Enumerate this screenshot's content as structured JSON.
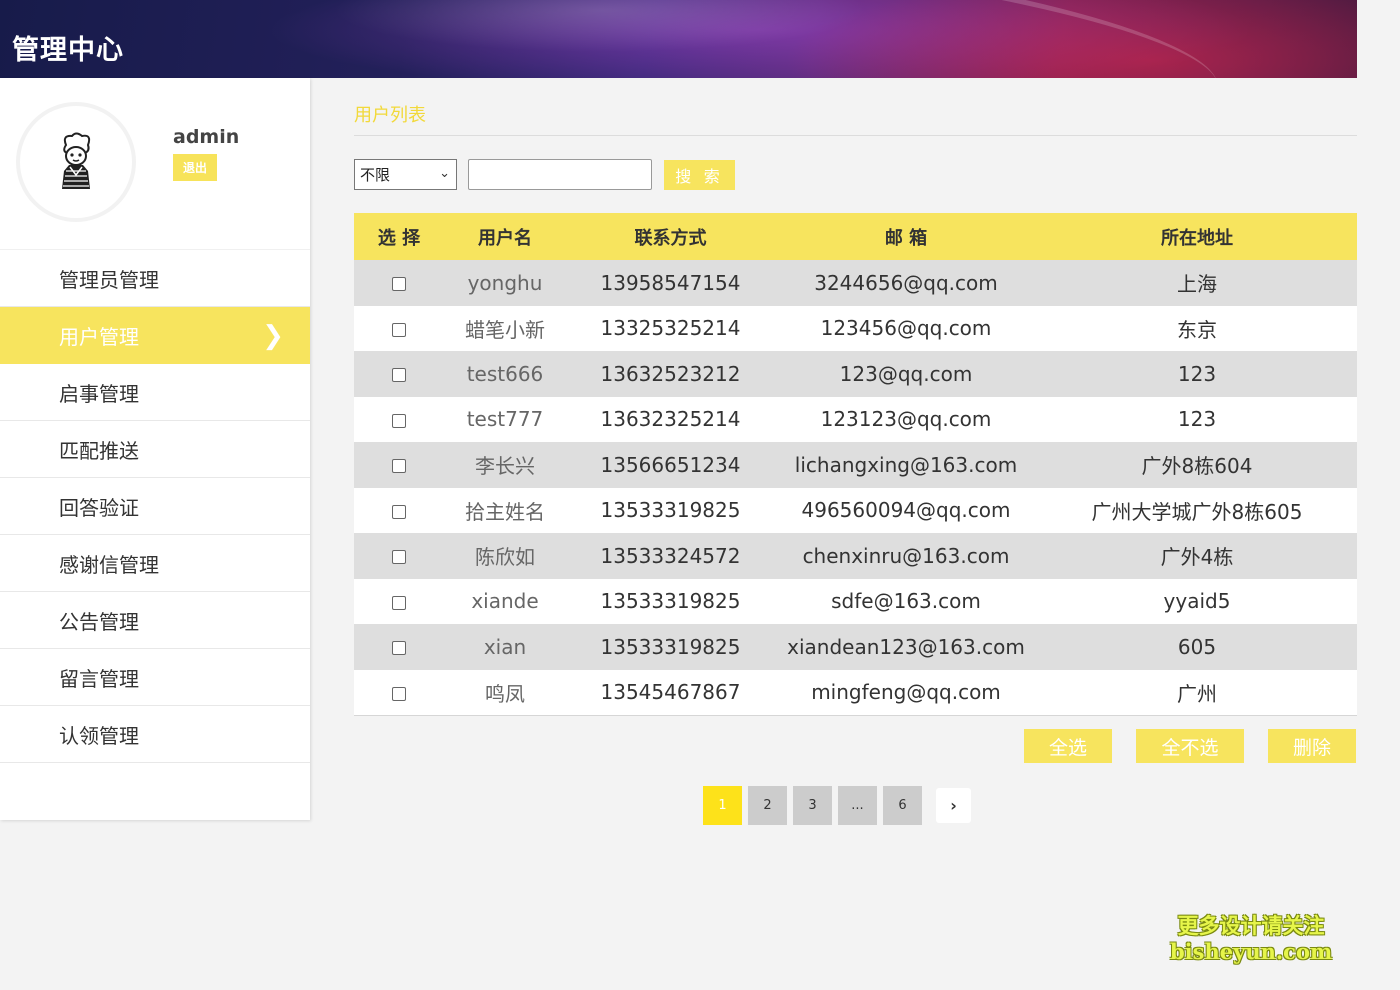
{
  "header": {
    "title": "管理中心"
  },
  "profile": {
    "username": "admin",
    "logout_label": "退出"
  },
  "menu": [
    {
      "label": "管理员管理",
      "active": false
    },
    {
      "label": "用户管理",
      "active": true
    },
    {
      "label": "启事管理",
      "active": false
    },
    {
      "label": "匹配推送",
      "active": false
    },
    {
      "label": "回答验证",
      "active": false
    },
    {
      "label": "感谢信管理",
      "active": false
    },
    {
      "label": "公告管理",
      "active": false
    },
    {
      "label": "留言管理",
      "active": false
    },
    {
      "label": "认领管理",
      "active": false
    }
  ],
  "main": {
    "section_title": "用户列表",
    "filter": {
      "selected": "不限"
    },
    "search": {
      "value": "",
      "button_label": "搜 索"
    },
    "table": {
      "headers": [
        "选 择",
        "用户名",
        "联系方式",
        "邮 箱",
        "所在地址"
      ],
      "rows": [
        {
          "username": "yonghu",
          "phone": "13958547154",
          "email": "3244656@qq.com",
          "address": "上海",
          "checked": false
        },
        {
          "username": "蜡笔小新",
          "phone": "13325325214",
          "email": "123456@qq.com",
          "address": "东京",
          "checked": false
        },
        {
          "username": "test666",
          "phone": "13632523212",
          "email": "123@qq.com",
          "address": "123",
          "checked": false
        },
        {
          "username": "test777",
          "phone": "13632325214",
          "email": "123123@qq.com",
          "address": "123",
          "checked": false
        },
        {
          "username": "李长兴",
          "phone": "13566651234",
          "email": "lichangxing@163.com",
          "address": "广外8栋604",
          "checked": false
        },
        {
          "username": "拾主姓名",
          "phone": "13533319825",
          "email": "496560094@qq.com",
          "address": "广州大学城广外8栋605",
          "checked": false
        },
        {
          "username": "陈欣如",
          "phone": "13533324572",
          "email": "chenxinru@163.com",
          "address": "广外4栋",
          "checked": false
        },
        {
          "username": "xiande",
          "phone": "13533319825",
          "email": "sdfe@163.com",
          "address": "yyaid5",
          "checked": false
        },
        {
          "username": "xian",
          "phone": "13533319825",
          "email": "xiandean123@163.com",
          "address": "605",
          "checked": false
        },
        {
          "username": "鸣凤",
          "phone": "13545467867",
          "email": "mingfeng@qq.com",
          "address": "广州",
          "checked": false
        }
      ]
    },
    "actions": {
      "select_all": "全选",
      "select_none": "全不选",
      "delete": "删除"
    },
    "pagination": {
      "pages": [
        "1",
        "2",
        "3",
        "...",
        "6"
      ],
      "current": "1",
      "next_icon": "chevron-right-icon"
    }
  },
  "watermark": {
    "line1": "更多设计请关注",
    "line2": "bisheyun.com"
  },
  "colors": {
    "accent": "#f7e45e",
    "header_dark": "#1c1d4e",
    "row_alt": "#dedede"
  }
}
